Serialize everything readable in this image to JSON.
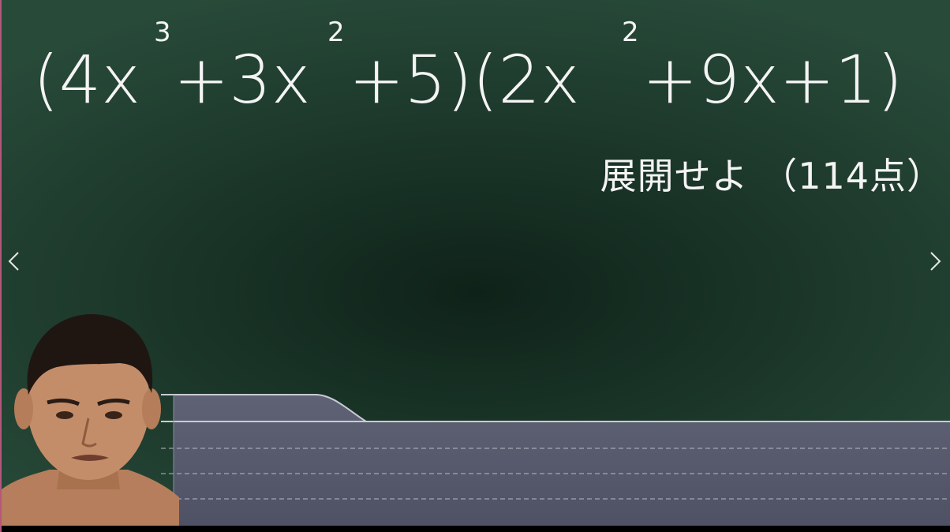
{
  "equation": {
    "parts": [
      {
        "text": "(4x",
        "sup": "3"
      },
      {
        "text": "+3x",
        "sup": "2"
      },
      {
        "text": "+5)(2x",
        "sup": "2"
      },
      {
        "text": "+9x+1)",
        "sup": ""
      }
    ],
    "full_text": "(4x³+3x²+5)(2x²+9x+1)"
  },
  "instruction": "展開せよ （114点）",
  "navigation": {
    "prev_icon": "chevron-left-icon",
    "next_icon": "chevron-right-icon"
  },
  "colors": {
    "chalkboard": "#1a3528",
    "chalk_text": "#f4f4f4",
    "floor_panel": "#575b6e",
    "left_border": "#b4577a"
  }
}
